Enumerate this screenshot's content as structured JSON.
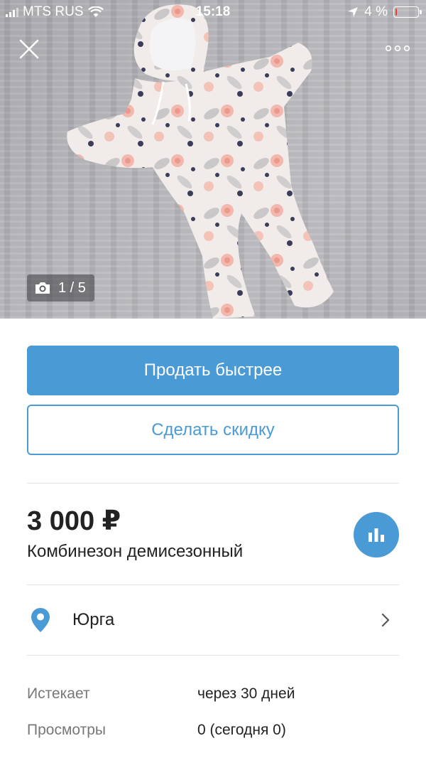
{
  "status_bar": {
    "carrier": "MTS RUS",
    "time": "15:18",
    "battery": "4 %",
    "battery_level": 0.04
  },
  "gallery": {
    "counter": "1 / 5"
  },
  "actions": {
    "sell_faster_label": "Продать быстрее",
    "discount_label": "Сделать скидку"
  },
  "listing": {
    "price": "3 000 ₽",
    "title": "Комбинезон демисезонный"
  },
  "location": {
    "city": "Юрга"
  },
  "meta": {
    "expires_label": "Истекает",
    "expires_value": "через 30 дней",
    "views_label": "Просмотры",
    "views_value": "0 (сегодня 0)"
  },
  "colors": {
    "accent": "#4a9ad6",
    "battery_low": "#ff3b30"
  },
  "icons": {
    "close": "close-icon",
    "more": "more-dots-icon",
    "camera": "camera-icon",
    "stats": "bar-chart-icon",
    "location": "location-pin-icon",
    "chevron": "chevron-right-icon"
  }
}
